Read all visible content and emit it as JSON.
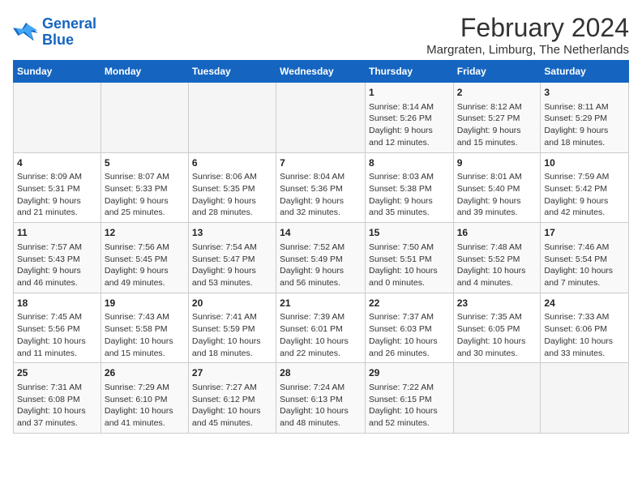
{
  "logo": {
    "line1": "General",
    "line2": "Blue"
  },
  "title": "February 2024",
  "subtitle": "Margraten, Limburg, The Netherlands",
  "days_of_week": [
    "Sunday",
    "Monday",
    "Tuesday",
    "Wednesday",
    "Thursday",
    "Friday",
    "Saturday"
  ],
  "weeks": [
    [
      {
        "day": "",
        "content": ""
      },
      {
        "day": "",
        "content": ""
      },
      {
        "day": "",
        "content": ""
      },
      {
        "day": "",
        "content": ""
      },
      {
        "day": "1",
        "content": "Sunrise: 8:14 AM\nSunset: 5:26 PM\nDaylight: 9 hours\nand 12 minutes."
      },
      {
        "day": "2",
        "content": "Sunrise: 8:12 AM\nSunset: 5:27 PM\nDaylight: 9 hours\nand 15 minutes."
      },
      {
        "day": "3",
        "content": "Sunrise: 8:11 AM\nSunset: 5:29 PM\nDaylight: 9 hours\nand 18 minutes."
      }
    ],
    [
      {
        "day": "4",
        "content": "Sunrise: 8:09 AM\nSunset: 5:31 PM\nDaylight: 9 hours\nand 21 minutes."
      },
      {
        "day": "5",
        "content": "Sunrise: 8:07 AM\nSunset: 5:33 PM\nDaylight: 9 hours\nand 25 minutes."
      },
      {
        "day": "6",
        "content": "Sunrise: 8:06 AM\nSunset: 5:35 PM\nDaylight: 9 hours\nand 28 minutes."
      },
      {
        "day": "7",
        "content": "Sunrise: 8:04 AM\nSunset: 5:36 PM\nDaylight: 9 hours\nand 32 minutes."
      },
      {
        "day": "8",
        "content": "Sunrise: 8:03 AM\nSunset: 5:38 PM\nDaylight: 9 hours\nand 35 minutes."
      },
      {
        "day": "9",
        "content": "Sunrise: 8:01 AM\nSunset: 5:40 PM\nDaylight: 9 hours\nand 39 minutes."
      },
      {
        "day": "10",
        "content": "Sunrise: 7:59 AM\nSunset: 5:42 PM\nDaylight: 9 hours\nand 42 minutes."
      }
    ],
    [
      {
        "day": "11",
        "content": "Sunrise: 7:57 AM\nSunset: 5:43 PM\nDaylight: 9 hours\nand 46 minutes."
      },
      {
        "day": "12",
        "content": "Sunrise: 7:56 AM\nSunset: 5:45 PM\nDaylight: 9 hours\nand 49 minutes."
      },
      {
        "day": "13",
        "content": "Sunrise: 7:54 AM\nSunset: 5:47 PM\nDaylight: 9 hours\nand 53 minutes."
      },
      {
        "day": "14",
        "content": "Sunrise: 7:52 AM\nSunset: 5:49 PM\nDaylight: 9 hours\nand 56 minutes."
      },
      {
        "day": "15",
        "content": "Sunrise: 7:50 AM\nSunset: 5:51 PM\nDaylight: 10 hours\nand 0 minutes."
      },
      {
        "day": "16",
        "content": "Sunrise: 7:48 AM\nSunset: 5:52 PM\nDaylight: 10 hours\nand 4 minutes."
      },
      {
        "day": "17",
        "content": "Sunrise: 7:46 AM\nSunset: 5:54 PM\nDaylight: 10 hours\nand 7 minutes."
      }
    ],
    [
      {
        "day": "18",
        "content": "Sunrise: 7:45 AM\nSunset: 5:56 PM\nDaylight: 10 hours\nand 11 minutes."
      },
      {
        "day": "19",
        "content": "Sunrise: 7:43 AM\nSunset: 5:58 PM\nDaylight: 10 hours\nand 15 minutes."
      },
      {
        "day": "20",
        "content": "Sunrise: 7:41 AM\nSunset: 5:59 PM\nDaylight: 10 hours\nand 18 minutes."
      },
      {
        "day": "21",
        "content": "Sunrise: 7:39 AM\nSunset: 6:01 PM\nDaylight: 10 hours\nand 22 minutes."
      },
      {
        "day": "22",
        "content": "Sunrise: 7:37 AM\nSunset: 6:03 PM\nDaylight: 10 hours\nand 26 minutes."
      },
      {
        "day": "23",
        "content": "Sunrise: 7:35 AM\nSunset: 6:05 PM\nDaylight: 10 hours\nand 30 minutes."
      },
      {
        "day": "24",
        "content": "Sunrise: 7:33 AM\nSunset: 6:06 PM\nDaylight: 10 hours\nand 33 minutes."
      }
    ],
    [
      {
        "day": "25",
        "content": "Sunrise: 7:31 AM\nSunset: 6:08 PM\nDaylight: 10 hours\nand 37 minutes."
      },
      {
        "day": "26",
        "content": "Sunrise: 7:29 AM\nSunset: 6:10 PM\nDaylight: 10 hours\nand 41 minutes."
      },
      {
        "day": "27",
        "content": "Sunrise: 7:27 AM\nSunset: 6:12 PM\nDaylight: 10 hours\nand 45 minutes."
      },
      {
        "day": "28",
        "content": "Sunrise: 7:24 AM\nSunset: 6:13 PM\nDaylight: 10 hours\nand 48 minutes."
      },
      {
        "day": "29",
        "content": "Sunrise: 7:22 AM\nSunset: 6:15 PM\nDaylight: 10 hours\nand 52 minutes."
      },
      {
        "day": "",
        "content": ""
      },
      {
        "day": "",
        "content": ""
      }
    ]
  ]
}
